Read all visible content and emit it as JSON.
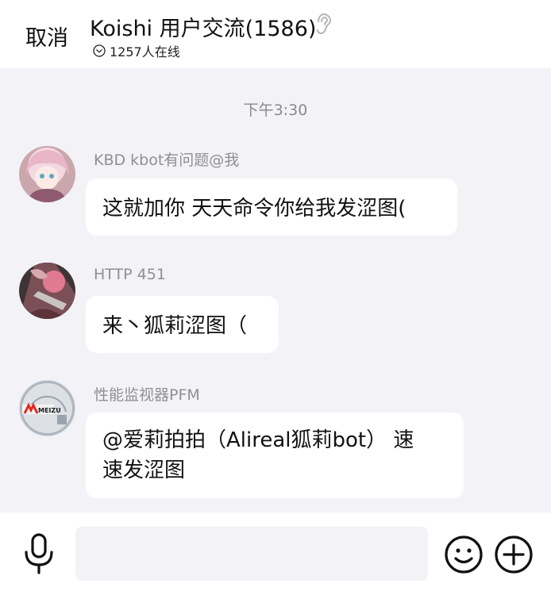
{
  "header": {
    "cancel_label": "取消",
    "title": "Koishi 用户交流(1586)",
    "online_text": "1257人在线",
    "icons": {
      "ear": "ear-icon",
      "online_toggle": "chevron-down-circle-icon"
    }
  },
  "chat": {
    "timestamp": "下午3:30",
    "messages": [
      {
        "sender": "KBD kbot有问题@我",
        "lines": [
          "这就加你 天天命令你给我发涩图("
        ]
      },
      {
        "sender": "HTTP 451",
        "lines": [
          "来丶狐莉涩图（"
        ]
      },
      {
        "sender": "性能监视器PFM",
        "lines": [
          "@爱莉拍拍（Alireal狐莉bot） 速",
          "速发涩图"
        ],
        "avatar_text": "MEIZU"
      }
    ]
  },
  "input_bar": {
    "placeholder": "",
    "icons": {
      "mic": "microphone-icon",
      "emoji": "emoji-icon",
      "plus": "plus-circle-icon"
    }
  }
}
